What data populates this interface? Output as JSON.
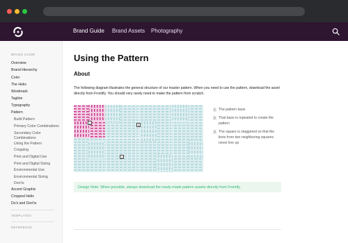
{
  "colors": {
    "browser_bar": "#2a2b2e",
    "header": "#2e1530",
    "pink": "#cc3e92",
    "teal": "#acd5db",
    "note_bg": "#ebf7ee",
    "note_text": "#2bb673"
  },
  "header": {
    "logo_icon": "swirl-logo-icon",
    "nav": [
      "Brand Guide",
      "Brand Assets",
      "Photography"
    ],
    "search_icon": "search-icon"
  },
  "sidebar": {
    "section_label": "BRAND GUIDE",
    "items": [
      {
        "label": "Overview"
      },
      {
        "label": "Brand Hierarchy"
      },
      {
        "label": "Color"
      },
      {
        "label": "The Helix"
      },
      {
        "label": "Wordmark"
      },
      {
        "label": "Tagline"
      },
      {
        "label": "Typography"
      },
      {
        "label": "Pattern"
      }
    ],
    "sub_items": [
      {
        "label": "Build Pattern"
      },
      {
        "label": "Primary Color Combinations"
      },
      {
        "label": "Secondary Color"
      },
      {
        "label": "Combinations"
      },
      {
        "label": "Using the Pattern"
      },
      {
        "label": "Cropping"
      },
      {
        "label": "Print and Digital Use"
      },
      {
        "label": "Print and Digital Sizing"
      },
      {
        "label": "Environmental Use"
      },
      {
        "label": "Environmental Sizing"
      },
      {
        "label": "Don'ts"
      }
    ],
    "after_items": [
      {
        "label": "Accent Graphic"
      },
      {
        "label": "Cropped Helix"
      },
      {
        "label": "Do's and Don'ts"
      }
    ],
    "templates_label": "TEMPLATES",
    "reference_label": "REFERENCE"
  },
  "main": {
    "title": "Using the Pattern",
    "section_title": "About",
    "intro": "The following diagram illustrates the general structure of our master pattern. When you need to use the pattern, download the asset directly from Frontify. You should very rarely need to make the pattern from scratch.",
    "markers": [
      "1",
      "2",
      "3"
    ],
    "legend": [
      {
        "num": "1",
        "text": "The pattern base"
      },
      {
        "num": "2",
        "text": "That base is repeated to create the pattern"
      },
      {
        "num": "3",
        "text": "The square is staggered so that the lines from two neighboring squares never line up"
      }
    ],
    "note": "Design Note: When possible, always download the ready-made pattern assets directly from Frontify."
  }
}
